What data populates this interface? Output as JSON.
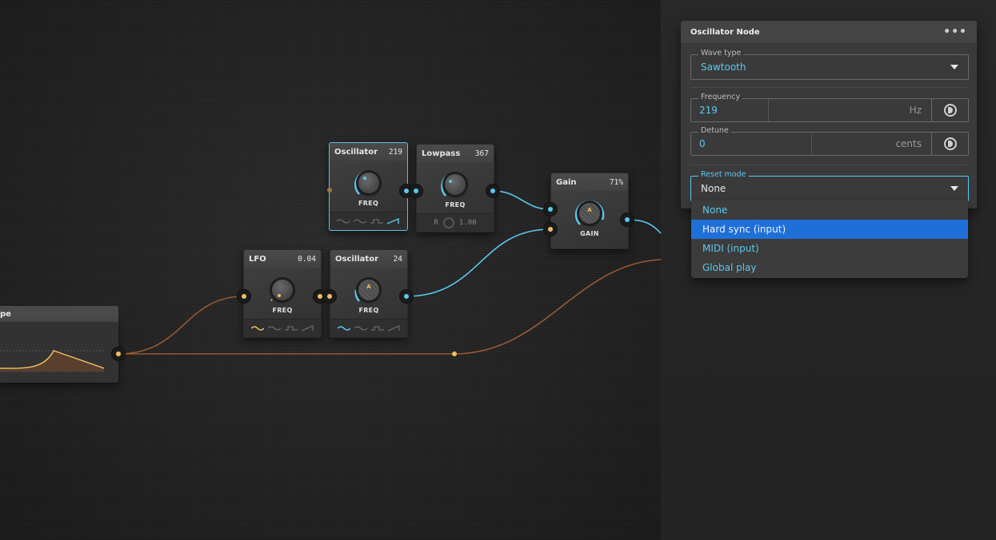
{
  "nodes": {
    "oscillator_a": {
      "title": "Oscillator",
      "value": "219",
      "knob_label": "FREQ"
    },
    "lowpass": {
      "title": "Lowpass",
      "value": "367",
      "knob_label": "FREQ",
      "footer_label": "R",
      "footer_value": "1.00"
    },
    "gain": {
      "title": "Gain",
      "value": "71%",
      "knob_label": "GAIN",
      "knob_letter": "A"
    },
    "lfo": {
      "title": "LFO",
      "value": "0.04",
      "knob_label": "FREQ"
    },
    "oscillator_b": {
      "title": "Oscillator",
      "value": "24",
      "knob_label": "FREQ",
      "knob_letter": "A"
    },
    "envelope": {
      "title": "pe"
    }
  },
  "panel": {
    "title": "Oscillator Node",
    "menu_icon": "more-dots-icon",
    "wave_type": {
      "label": "Wave type",
      "value": "Sawtooth"
    },
    "frequency": {
      "label": "Frequency",
      "value": "219",
      "unit": "Hz"
    },
    "detune": {
      "label": "Detune",
      "value": "0",
      "unit": "cents"
    },
    "reset_mode": {
      "label": "Reset mode",
      "value": "None"
    }
  },
  "dropdown": {
    "options": [
      "None",
      "Hard sync (input)",
      "MIDI (input)",
      "Global play"
    ],
    "highlighted": "Hard sync (input)"
  },
  "colors": {
    "accent_blue": "#5cc8f0",
    "accent_orange": "#f0c060",
    "highlight": "#1f6fd8"
  }
}
